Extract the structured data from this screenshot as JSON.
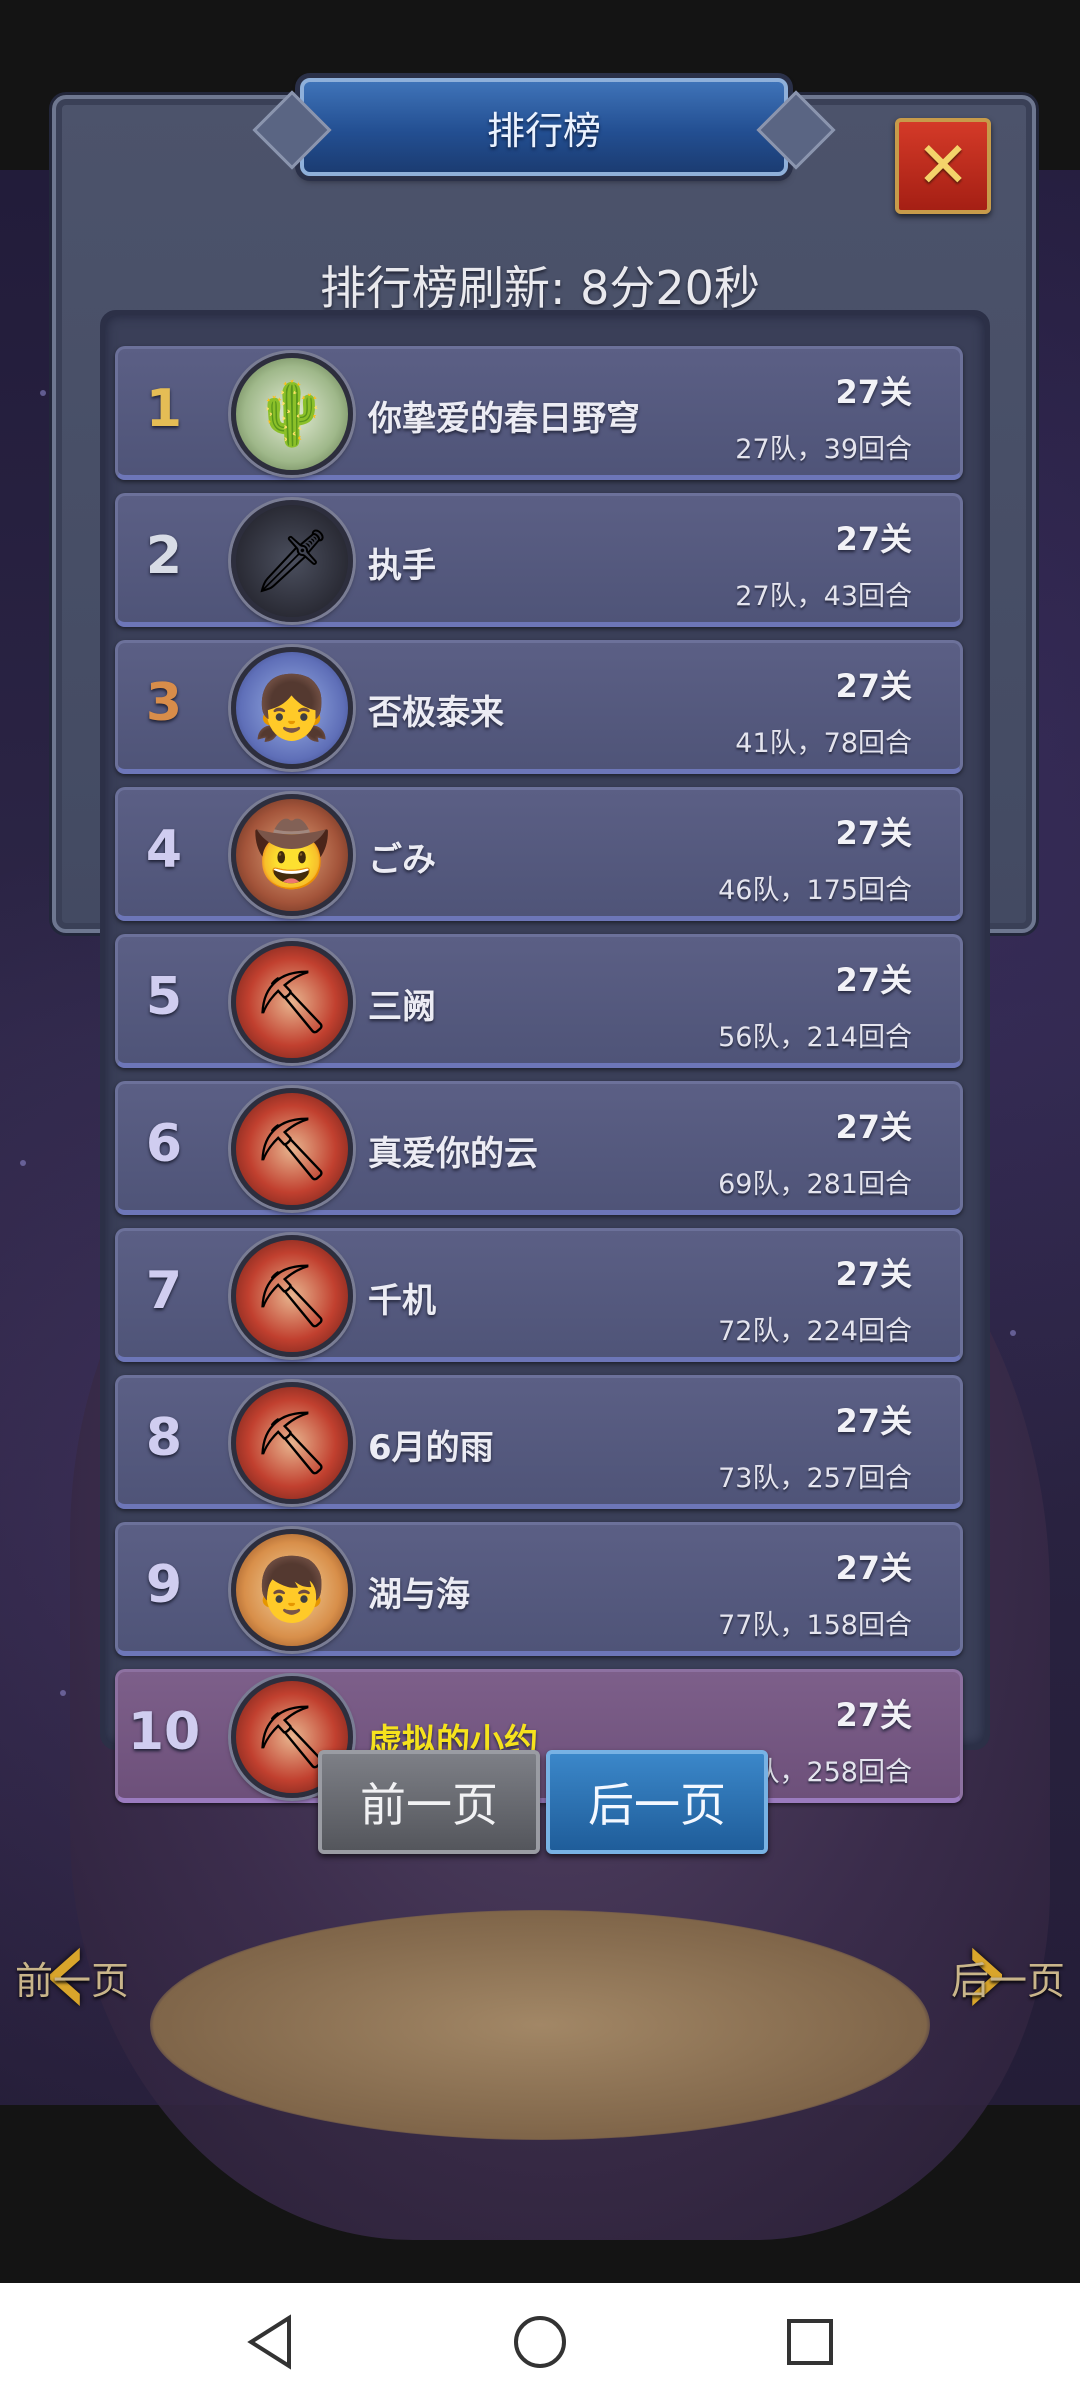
{
  "title": "排行榜",
  "close_icon": "close-icon",
  "refresh_text": "排行榜刷新: 8分20秒",
  "rows": [
    {
      "rank": "1",
      "name": "你挚爱的春日野穹",
      "level": "27关",
      "stats": "27队，39回合",
      "avatar": "aloe-plant-avatar"
    },
    {
      "rank": "2",
      "name": "执手",
      "level": "27关",
      "stats": "27队，43回合",
      "avatar": "dark-knight-avatar"
    },
    {
      "rank": "3",
      "name": "否极泰来",
      "level": "27关",
      "stats": "41队，78回合",
      "avatar": "blue-hair-girl-avatar"
    },
    {
      "rank": "4",
      "name": "ごみ",
      "level": "27关",
      "stats": "46队，175回合",
      "avatar": "cowboy-hat-avatar"
    },
    {
      "rank": "5",
      "name": "三阙",
      "level": "27关",
      "stats": "56队，214回合",
      "avatar": "miner-dwarf-avatar"
    },
    {
      "rank": "6",
      "name": "真爱你的云",
      "level": "27关",
      "stats": "69队，281回合",
      "avatar": "miner-dwarf-avatar"
    },
    {
      "rank": "7",
      "name": "千机",
      "level": "27关",
      "stats": "72队，224回合",
      "avatar": "miner-dwarf-avatar"
    },
    {
      "rank": "8",
      "name": "6月的雨",
      "level": "27关",
      "stats": "73队，257回合",
      "avatar": "miner-dwarf-avatar"
    },
    {
      "rank": "9",
      "name": "湖与海",
      "level": "27关",
      "stats": "77队，158回合",
      "avatar": "red-hair-boy-avatar"
    },
    {
      "rank": "10",
      "name": "虚拟的小约",
      "level": "27关",
      "stats": "93队，258回合",
      "avatar": "miner-dwarf-avatar"
    }
  ],
  "pager": {
    "prev": "前一页",
    "next": "后一页"
  },
  "side_nav": {
    "prev": "前一页",
    "next": "后一页"
  },
  "colors": {
    "highlight_name": "#f6e21d",
    "gold_rank": "#e5bd55",
    "panel": "#4c536b",
    "row": "#5b5f85"
  }
}
